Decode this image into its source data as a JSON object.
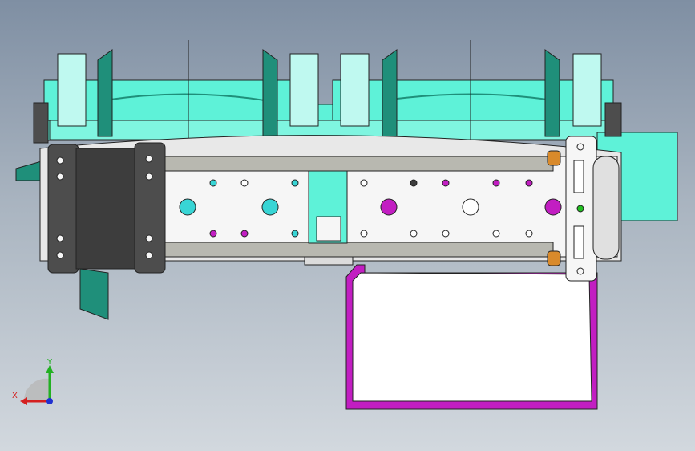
{
  "viewport": {
    "background_top": "#7f8fa3",
    "background_bottom": "#d2d8de"
  },
  "colors": {
    "cyan_light": "#5ef2d8",
    "cyan_pale": "#bff9f0",
    "teal_dark": "#1f8f7a",
    "frame_grey": "#4d4d4d",
    "rail_grey": "#b8b8b0",
    "plate_white": "#f6f6f6",
    "magenta": "#c21ec2",
    "orange": "#d98a2b",
    "hole_cyan": "#38d5d5",
    "outline": "#222222"
  },
  "triad": {
    "x_label": "X",
    "y_label": "Y",
    "x_color": "#d42020",
    "y_color": "#22b022",
    "z_color": "#2030d0"
  }
}
